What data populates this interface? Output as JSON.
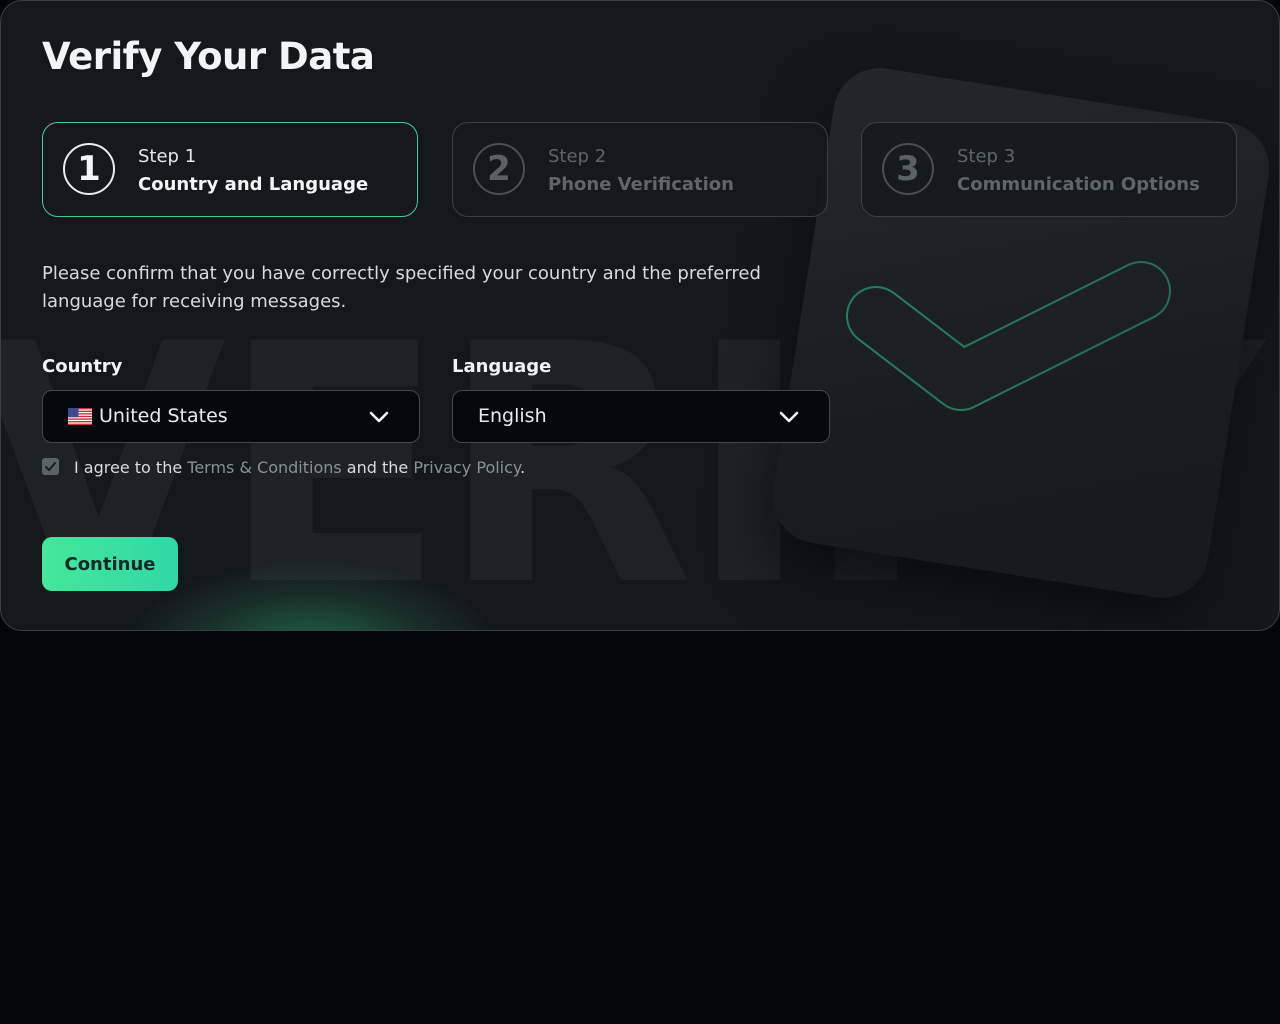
{
  "bg_text": "VERIFY",
  "title": "Verify Your Data",
  "steps": [
    {
      "number": "1",
      "label": "Step 1",
      "title": "Country and Language",
      "active": true
    },
    {
      "number": "2",
      "label": "Step 2",
      "title": "Phone Verification",
      "active": false
    },
    {
      "number": "3",
      "label": "Step 3",
      "title": "Communication Options",
      "active": false
    }
  ],
  "description": "Please confirm that you have correctly specified your country and the preferred language for receiving messages.",
  "country": {
    "label": "Country",
    "value": "United States",
    "flag_icon": "us-flag-icon"
  },
  "language": {
    "label": "Language",
    "value": "English"
  },
  "agreement": {
    "checked": true,
    "prefix": "I agree to the ",
    "terms_link": "Terms & Conditions",
    "middle": " and the ",
    "privacy_link": "Privacy Policy",
    "suffix": "."
  },
  "continue_label": "Continue",
  "colors": {
    "accent": "#3fcf95",
    "button_gradient_start": "#46e79a",
    "button_gradient_end": "#2fd8a6",
    "panel_bg": "#15181b",
    "page_bg": "#03070b"
  }
}
